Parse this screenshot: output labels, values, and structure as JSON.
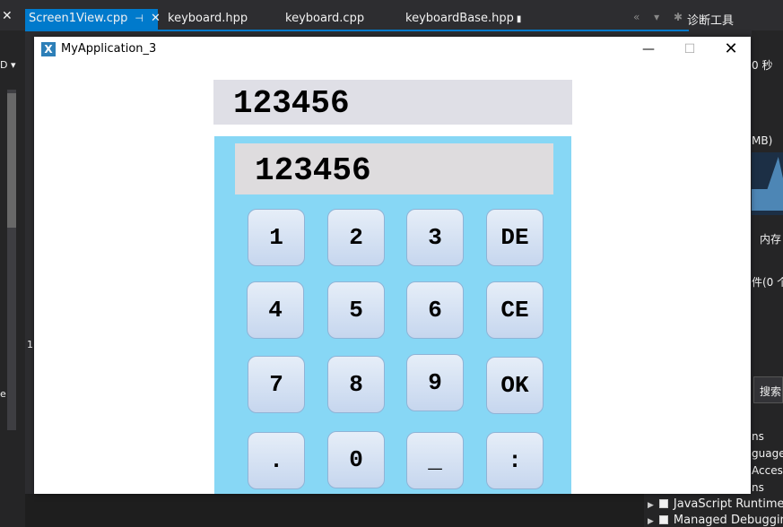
{
  "ide": {
    "left_close": "✕",
    "tabs": [
      {
        "label": "Screen1View.cpp",
        "pin": "⊣",
        "close": "✕"
      },
      {
        "label": "keyboard.hpp"
      },
      {
        "label": "keyboard.cpp"
      },
      {
        "label": "keyboardBase.hpp",
        "lock": "🔒"
      }
    ],
    "tab_controls": "« ▾ ✱",
    "right_panel_title": "诊断工具",
    "right_fragments": [
      "0 秒",
      "MB)",
      "内存",
      "件(0 个",
      "搜索"
    ],
    "left_fragments": [
      "D ▾",
      "1",
      "e"
    ],
    "bottom_list": [
      {
        "label": "JavaScript Runtime L"
      },
      {
        "label": "Managed Debugging"
      }
    ],
    "right_list_fragments": [
      "ns",
      "guage",
      "Access",
      "ns"
    ]
  },
  "app": {
    "title": "MyApplication_3",
    "icon_letter": "X",
    "minimize": "—",
    "maximize": "☐",
    "close": "✕",
    "outer_display": "123456",
    "inner_display": "123456",
    "keys": [
      "1",
      "2",
      "3",
      "DE",
      "4",
      "5",
      "6",
      "CE",
      "7",
      "8",
      "9",
      "OK",
      ".",
      "0",
      "_",
      ":"
    ]
  }
}
